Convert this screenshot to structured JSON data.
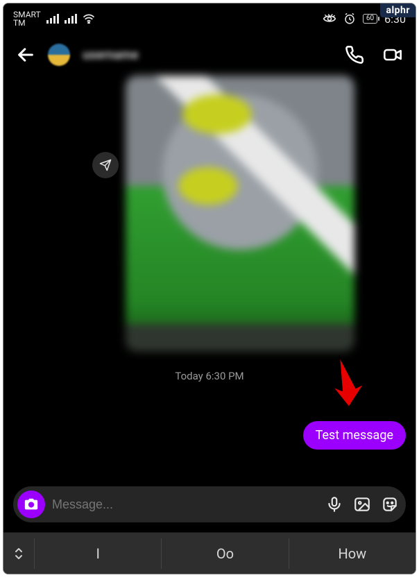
{
  "watermark": "alphr",
  "statusbar": {
    "carrier_line1": "SMART",
    "carrier_line2": "TM",
    "battery": "60",
    "time": "6:30"
  },
  "header": {
    "username_obscured": "username"
  },
  "chat": {
    "timestamp": "Today 6:30 PM",
    "sent_message": "Test message"
  },
  "input": {
    "placeholder": "Message..."
  },
  "suggestions": {
    "items": [
      "I",
      "Oo",
      "How"
    ]
  }
}
